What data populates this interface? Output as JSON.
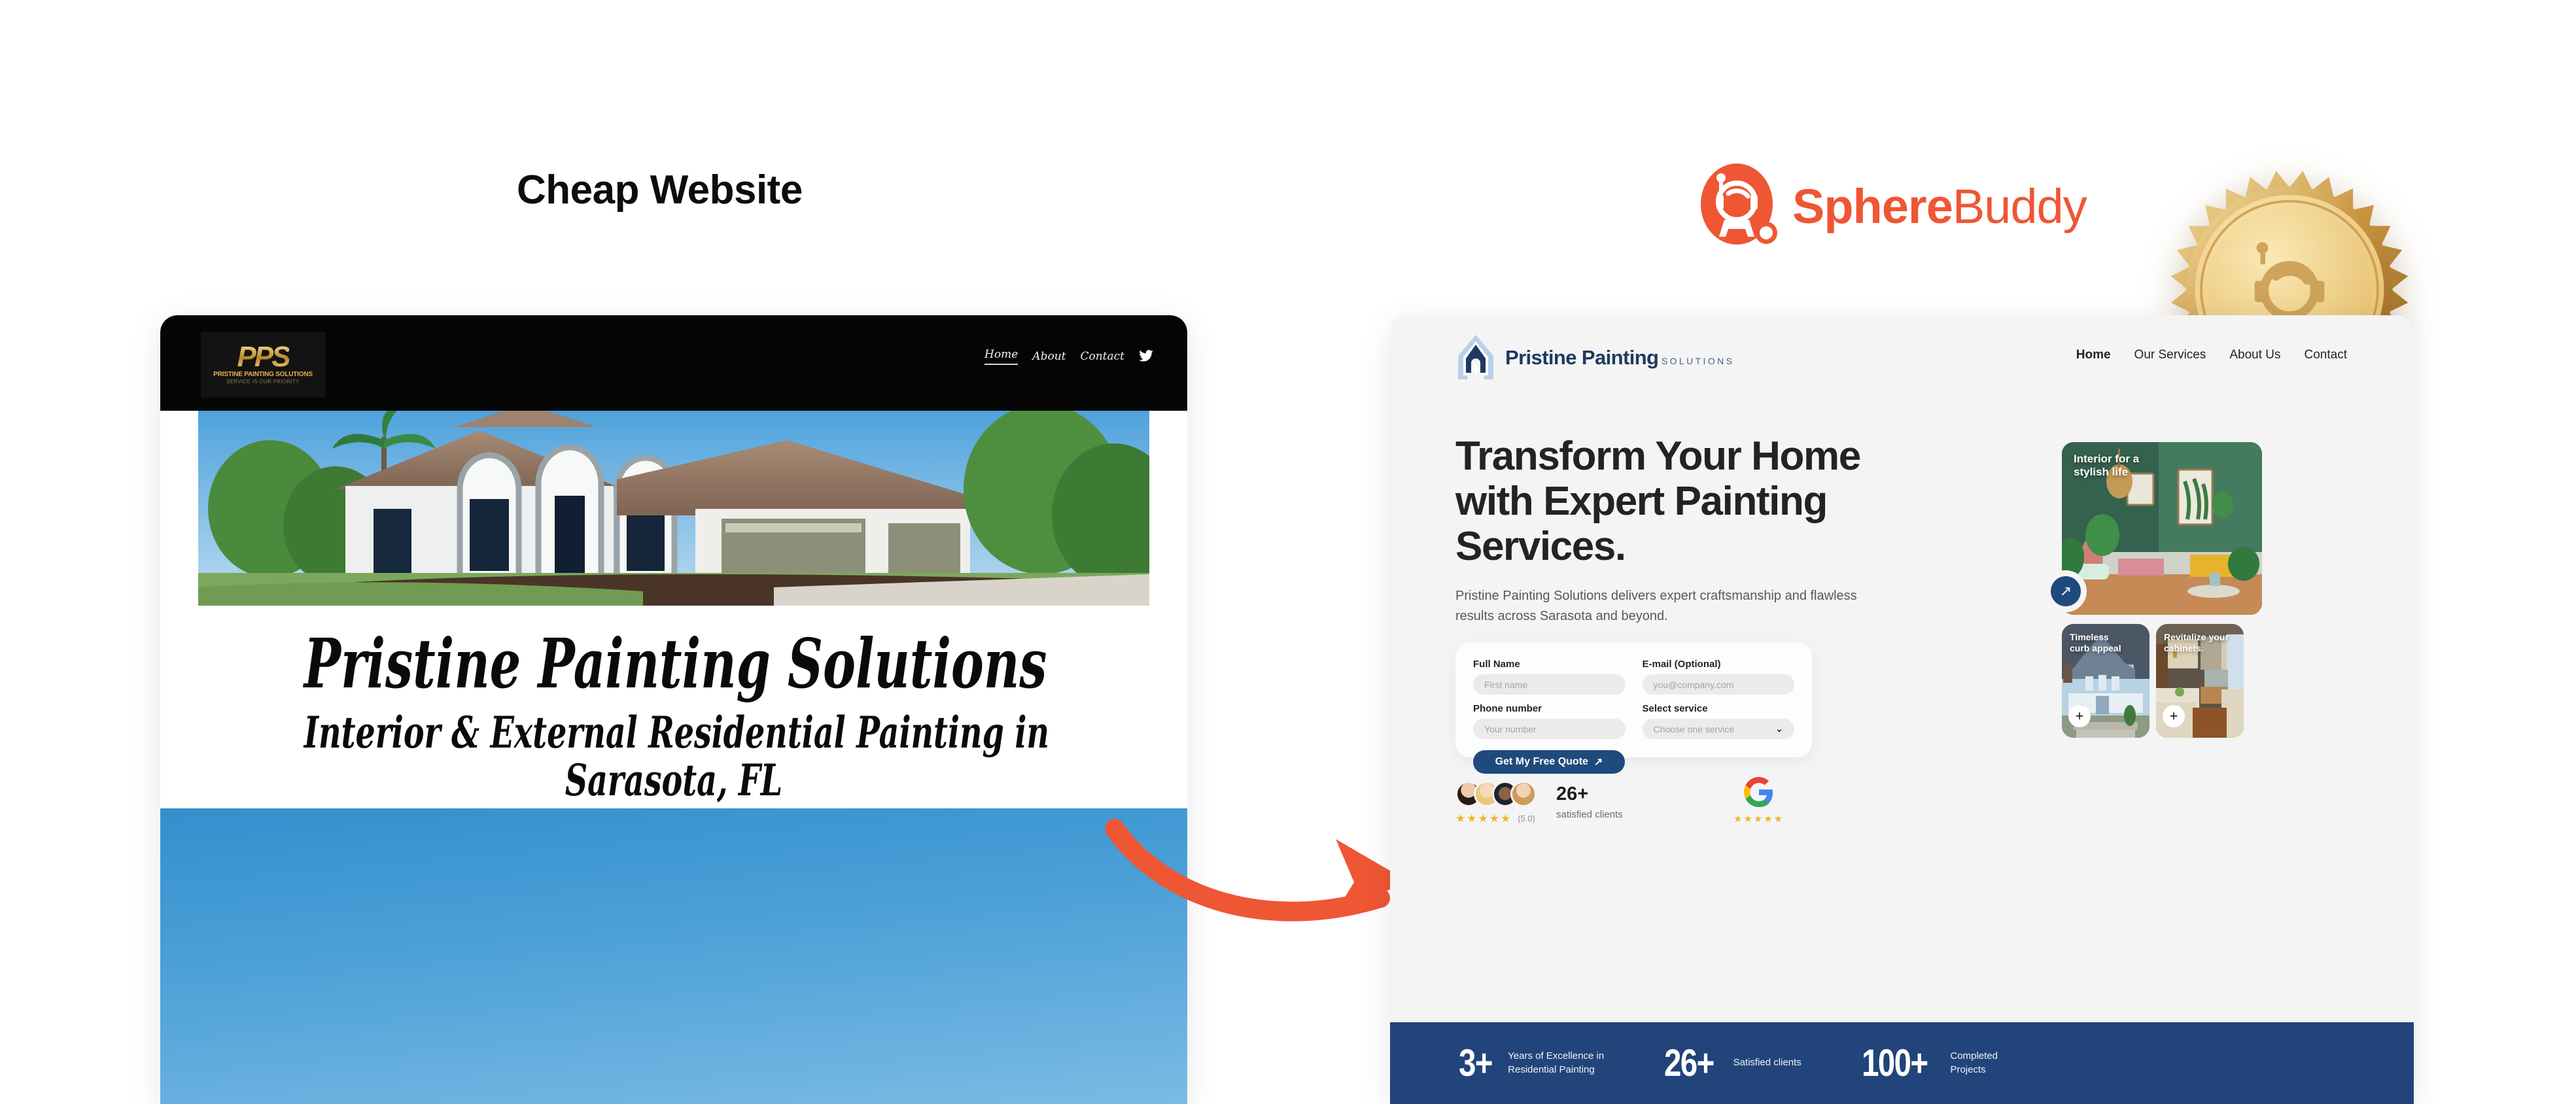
{
  "comparison": {
    "left_label": "Cheap Website"
  },
  "brand": {
    "name_bold": "Sphere",
    "name_light": "Buddy",
    "accent_color": "#ef5634",
    "astronaut_icon": "astronaut-icon",
    "seal_icon": "gold-award-seal-icon"
  },
  "flow": {
    "arrow_icon": "curved-arrow-right-icon",
    "arrow_color": "#ef5634"
  },
  "old_site": {
    "logo": {
      "mark": "PPS",
      "line1": "PRISTINE PAINTING SOLUTIONS",
      "line2": "SERVICE IS OUR PRIORITY"
    },
    "nav": [
      {
        "label": "Home",
        "active": true
      },
      {
        "label": "About",
        "active": false
      },
      {
        "label": "Contact",
        "active": false
      }
    ],
    "social_icon": "twitter-bird-icon",
    "hero_photo": "suburban-house-exterior-photo",
    "title": "Pristine Painting Solutions",
    "subtitle_line1": "Interior & External Residential Painting in",
    "subtitle_line2": "Sarasota, FL"
  },
  "new_site": {
    "logo": {
      "icon": "house-arch-logo-icon",
      "line1": "Pristine Painting",
      "line2": "SOLUTIONS"
    },
    "nav": [
      {
        "label": "Home",
        "active": true
      },
      {
        "label": "Our Services",
        "active": false
      },
      {
        "label": "About Us",
        "active": false
      },
      {
        "label": "Contact",
        "active": false
      }
    ],
    "hero": {
      "title": "Transform Your Home with Expert Painting Services.",
      "subtitle": "Pristine Painting Solutions delivers expert craftsmanship and flawless results across Sarasota and beyond."
    },
    "quote_form": {
      "fields": [
        {
          "label": "Full Name",
          "placeholder": "First name",
          "type": "text"
        },
        {
          "label": "E-mail (Optional)",
          "placeholder": "you@company.com",
          "type": "email"
        },
        {
          "label": "Phone number",
          "placeholder": "Your number",
          "type": "tel"
        },
        {
          "label": "Select service",
          "placeholder": "Choose one service",
          "type": "select"
        }
      ],
      "submit_label": "Get My Free Quote",
      "submit_icon": "arrow-up-right-icon",
      "submit_color": "#1e4a7d"
    },
    "social_proof": {
      "rating_stars": "★★★★★",
      "rating_value": "(5.0)",
      "count": "26+",
      "count_label": "satisfied clients",
      "google_icon": "google-logo-icon",
      "google_stars": "★★★★★"
    },
    "gallery": [
      {
        "caption": "Interior for a\nstylish life",
        "image": "green-living-room-photo",
        "badge": "arrow-up-right-icon"
      },
      {
        "caption": "Timeless\ncurb appeal",
        "image": "blue-victorian-house-photo",
        "badge": "plus-icon"
      },
      {
        "caption": "Revitalize your\ncabinets.",
        "image": "kitchen-cabinets-photo",
        "badge": "plus-icon"
      }
    ],
    "stats_bar": {
      "background": "#21447a",
      "items": [
        {
          "number": "3+",
          "label": "Years of Excellence in\nResidential Painting"
        },
        {
          "number": "26+",
          "label": "Satisfied clients"
        },
        {
          "number": "100+",
          "label": "Completed\nProjects"
        }
      ]
    }
  }
}
